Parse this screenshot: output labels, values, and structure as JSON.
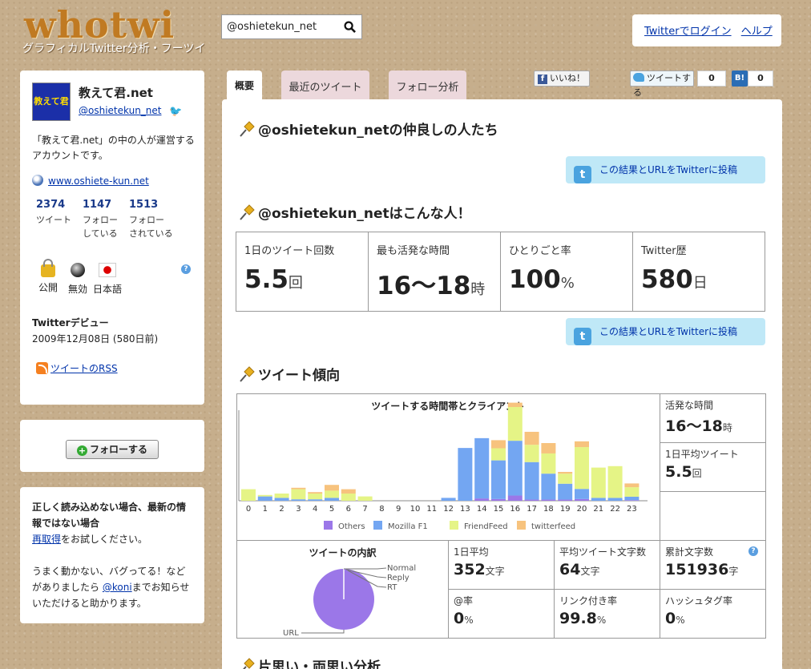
{
  "header": {
    "logo": "whotwi",
    "tagline": "グラフィカルTwitter分析・フーツイ",
    "search_value": "@oshietekun_net",
    "login_link": "Twitterでログイン",
    "help_link": "ヘルプ"
  },
  "profile": {
    "avatar_text": "教えて君",
    "name": "教えて君.net",
    "handle": "@oshietekun_net",
    "description": "「教えて君.net」の中の人が運営するアカウントです。",
    "url": "www.oshiete-kun.net",
    "stats": [
      {
        "num": "2374",
        "label": "ツイート"
      },
      {
        "num": "1147",
        "label": "フォロー している"
      },
      {
        "num": "1513",
        "label": "フォロー されている"
      }
    ],
    "flags": [
      {
        "label": "公開",
        "icon": "lock-icon"
      },
      {
        "label": "無効",
        "icon": "disc-icon"
      },
      {
        "label": "日本語",
        "icon": "japan-flag-icon"
      }
    ],
    "debut_title": "Twitterデビュー",
    "debut_date": "2009年12月08日 (580日前)",
    "rss_link": "ツイートのRSS"
  },
  "follow_button": "フォローする",
  "notice": {
    "title": "正しく読み込めない場合、最新の情報ではない場合",
    "retry_link": "再取得",
    "retry_suffix": "をお試しください。",
    "bug_text": "うまく動かない、バグってる！などがありましたら",
    "contact_link": "@koni",
    "contact_suffix": "までお知らせいただけると助かります。"
  },
  "tabs": [
    "概要",
    "最近のツイート",
    "フォロー分析"
  ],
  "social": {
    "like": "いいね！",
    "tweet": "ツイートする",
    "tweet_count": "0",
    "hatena": "B!",
    "hatena_count": "0"
  },
  "sections": {
    "friends": "@oshietekun_netの仲良しの人たち",
    "person": "@oshietekun_netはこんな人！",
    "trend": "ツイート傾向",
    "oneway": "片思い・両思い分析"
  },
  "post_button": "この結果とURLをTwitterに投稿",
  "overview": [
    {
      "label": "1日のツイート回数",
      "value": "5.5",
      "unit": "回"
    },
    {
      "label": "最も活発な時間",
      "value": "16～18",
      "unit": "時"
    },
    {
      "label": "ひとりごと率",
      "value": "100",
      "unit": "%"
    },
    {
      "label": "Twitter歴",
      "value": "580",
      "unit": "日"
    }
  ],
  "side_stats": [
    {
      "label": "活発な時間",
      "value": "16～18",
      "unit": "時"
    },
    {
      "label": "1日平均ツイート",
      "value": "5.5",
      "unit": "回"
    }
  ],
  "breakdown": {
    "title": "ツイートの内訳",
    "labels": [
      "Normal",
      "Reply",
      "RT",
      "URL"
    ]
  },
  "stats_grid": [
    {
      "label": "1日平均",
      "value": "352",
      "unit": "文字"
    },
    {
      "label": "平均ツイート文字数",
      "value": "64",
      "unit": "文字"
    },
    {
      "label": "累計文字数",
      "value": "151936",
      "unit": "字"
    },
    {
      "label": "@率",
      "value": "0",
      "unit": "%"
    },
    {
      "label": "リンク付き率",
      "value": "99.8",
      "unit": "%"
    },
    {
      "label": "ハッシュタグ率",
      "value": "0",
      "unit": "%"
    }
  ],
  "chart_data": {
    "type": "bar",
    "title": "ツイートする時間帯とクライアント",
    "categories": [
      "0",
      "1",
      "2",
      "3",
      "4",
      "5",
      "6",
      "7",
      "8",
      "9",
      "10",
      "11",
      "12",
      "13",
      "14",
      "15",
      "16",
      "17",
      "18",
      "19",
      "20",
      "21",
      "22",
      "23"
    ],
    "series": [
      {
        "name": "Others",
        "color": "#9b77e8",
        "values": [
          0,
          0,
          0,
          0,
          0,
          0,
          0,
          0,
          0,
          0,
          0,
          0,
          0,
          0,
          0.08,
          0.06,
          0.18,
          0.04,
          0.04,
          0.04,
          0.06,
          0,
          0,
          0.02
        ]
      },
      {
        "name": "Mozilla F1",
        "color": "#73a6f2",
        "values": [
          0,
          0.15,
          0.1,
          0.05,
          0.05,
          0.1,
          0,
          0,
          0,
          0,
          0,
          0,
          0.1,
          1.83,
          2.09,
          1.34,
          1.9,
          1.3,
          0.9,
          0.55,
          0.35,
          0.1,
          0.1,
          0.12
        ]
      },
      {
        "name": "FriendFeed",
        "color": "#e5f486",
        "values": [
          0.4,
          0.05,
          0.15,
          0.35,
          0.2,
          0.25,
          0.25,
          0.15,
          0,
          0,
          0,
          0,
          0,
          0,
          0,
          0.42,
          1.17,
          0.6,
          0.7,
          0.35,
          1.45,
          1.05,
          1.1,
          0.33
        ]
      },
      {
        "name": "twitterfeed",
        "color": "#f7c37e",
        "values": [
          0,
          0,
          0,
          0.05,
          0.05,
          0.2,
          0.15,
          0,
          0,
          0,
          0,
          0,
          0,
          0,
          0,
          0.28,
          0.15,
          0.45,
          0.36,
          0.06,
          0.2,
          0,
          0,
          0.13
        ]
      }
    ],
    "ylim": [
      0,
      3
    ],
    "legend": "bottom"
  }
}
